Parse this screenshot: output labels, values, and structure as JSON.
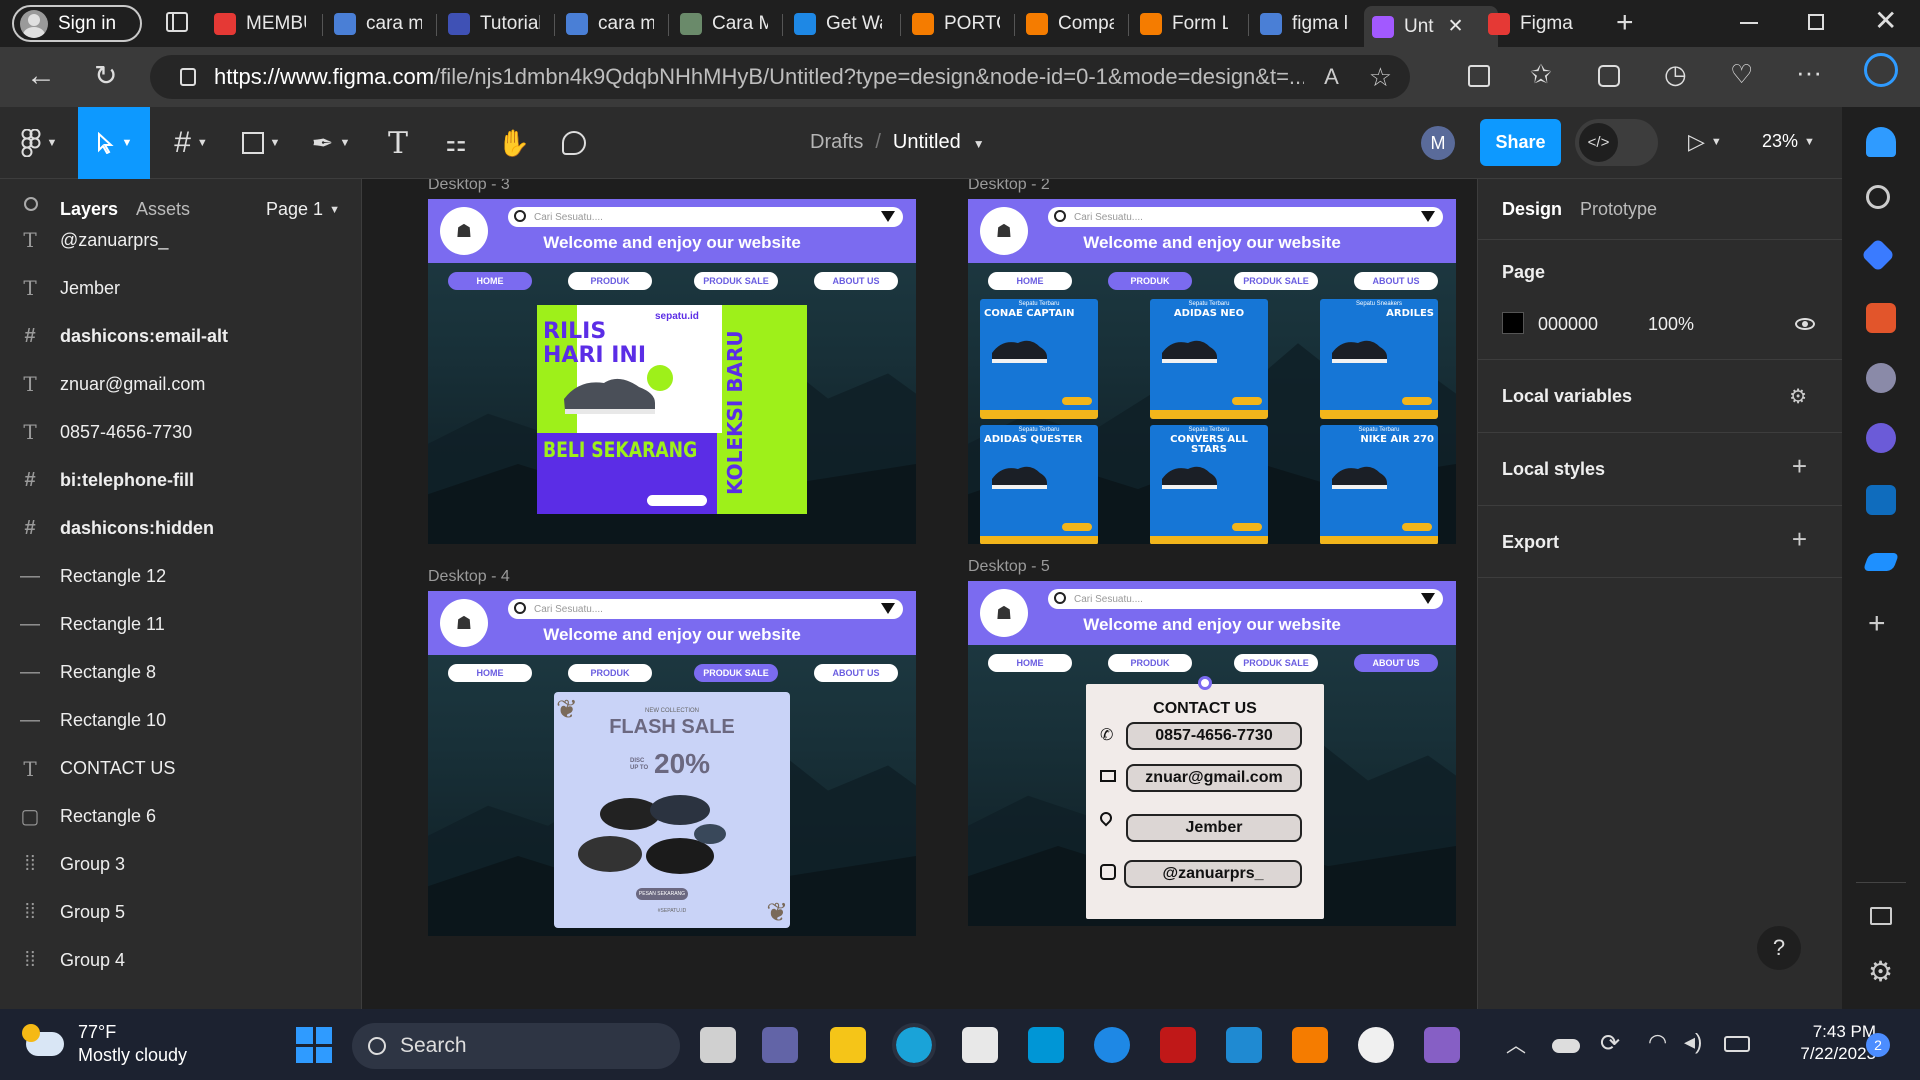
{
  "browser": {
    "signin_label": "Sign in",
    "tabs": [
      {
        "label": "MEMBU",
        "favicon": "youtube-icon",
        "color": "#e53935"
      },
      {
        "label": "cara me",
        "favicon": "search-icon",
        "color": "#4a7fd6"
      },
      {
        "label": "Tutorial",
        "favicon": "dicoding-icon",
        "color": "#3f51b5"
      },
      {
        "label": "cara me",
        "favicon": "search-icon",
        "color": "#4a7fd6"
      },
      {
        "label": "Cara M",
        "favicon": "site-icon",
        "color": "#6a8a6a"
      },
      {
        "label": "Get Wa",
        "favicon": "edge-icon",
        "color": "#1e88e5"
      },
      {
        "label": "PORTO",
        "favicon": "xampp-icon",
        "color": "#f57c00"
      },
      {
        "label": "Compa",
        "favicon": "xampp-icon",
        "color": "#f57c00"
      },
      {
        "label": "Form Lo",
        "favicon": "xampp-icon",
        "color": "#f57c00"
      },
      {
        "label": "figma lo",
        "favicon": "search-icon",
        "color": "#4a7fd6"
      },
      {
        "label": "Unt",
        "favicon": "figma-icon",
        "color": "#a259ff",
        "active": true
      },
      {
        "label": "Figma t",
        "favicon": "youtube-icon",
        "color": "#e53935"
      }
    ],
    "url_host": "https://www.figma.com",
    "url_path": "/file/njs1dmbn4k9QdqbNHhMHyB/Untitled?type=design&node-id=0-1&mode=design&t=..."
  },
  "figma": {
    "breadcrumb_parent": "Drafts",
    "breadcrumb_sep": "/",
    "file_name": "Untitled",
    "user_initial": "M",
    "share_label": "Share",
    "zoom": "23%",
    "left_tabs": {
      "layers": "Layers",
      "assets": "Assets",
      "page": "Page 1"
    },
    "layers": [
      {
        "name": "@zanuarprs_",
        "type": "text"
      },
      {
        "name": "Jember",
        "type": "text"
      },
      {
        "name": "dashicons:email-alt",
        "type": "frame"
      },
      {
        "name": "znuar@gmail.com",
        "type": "text"
      },
      {
        "name": "0857-4656-7730",
        "type": "text"
      },
      {
        "name": "bi:telephone-fill",
        "type": "frame"
      },
      {
        "name": "dashicons:hidden",
        "type": "frame"
      },
      {
        "name": "Rectangle 12",
        "type": "line"
      },
      {
        "name": "Rectangle 11",
        "type": "line"
      },
      {
        "name": "Rectangle 8",
        "type": "line"
      },
      {
        "name": "Rectangle 10",
        "type": "line"
      },
      {
        "name": "CONTACT US",
        "type": "text"
      },
      {
        "name": "Rectangle 6",
        "type": "rect"
      },
      {
        "name": "Group 3",
        "type": "group"
      },
      {
        "name": "Group 5",
        "type": "group"
      },
      {
        "name": "Group 4",
        "type": "group"
      }
    ],
    "right_tabs": {
      "design": "Design",
      "prototype": "Prototype"
    },
    "page_section": {
      "title": "Page",
      "color_hex": "000000",
      "opacity": "100%",
      "swatch": "#000000"
    },
    "sections": [
      "Local variables",
      "Local styles",
      "Export"
    ]
  },
  "canvas": {
    "frames": [
      {
        "label": "Desktop - 3",
        "active_nav": 0
      },
      {
        "label": "Desktop - 2",
        "active_nav": 1
      },
      {
        "label": "Desktop - 4",
        "active_nav": 2
      },
      {
        "label": "Desktop - 5",
        "active_nav": 3
      }
    ],
    "site": {
      "search_placeholder": "Cari Sesuatu....",
      "welcome": "Welcome and enjoy our website",
      "nav": [
        "HOME",
        "PRODUK",
        "PRODUK SALE",
        "ABOUT US"
      ]
    },
    "promo": {
      "headline1": "RILIS",
      "headline2": "HARI INI",
      "brand": "sepatu.id",
      "cta": "BELI SEKARANG",
      "side": "KOLEKSI BARU"
    },
    "products": [
      {
        "kicker": "Sepatu Terbaru",
        "name": "CONAE CAPTAIN"
      },
      {
        "kicker": "Sepatu Terbaru",
        "name": "ADIDAS NEO"
      },
      {
        "kicker": "Sepatu Sneakers",
        "name": "ARDILES"
      },
      {
        "kicker": "Sepatu Terbaru",
        "name": "ADIDAS QUESTER"
      },
      {
        "kicker": "Sepatu Terbaru",
        "name": "CONVERS ALL STARS"
      },
      {
        "kicker": "Sepatu Terbaru",
        "name": "NIKE AIR 270"
      }
    ],
    "flash": {
      "kicker": "NEW COLLECTION",
      "title": "FLASH SALE",
      "disc_label": "DISC UP TO",
      "disc": "20%",
      "cta": "PESAN SEKARANG",
      "tag": "#SEPATU.ID"
    },
    "contact": {
      "title": "CONTACT US",
      "phone": "0857-4656-7730",
      "email": "znuar@gmail.com",
      "city": "Jember",
      "instagram": "@zanuarprs_"
    }
  },
  "taskbar": {
    "weather_temp": "77°F",
    "weather_desc": "Mostly cloudy",
    "search_label": "Search",
    "time": "7:43 PM",
    "date": "7/22/2023",
    "notif_count": "2"
  }
}
